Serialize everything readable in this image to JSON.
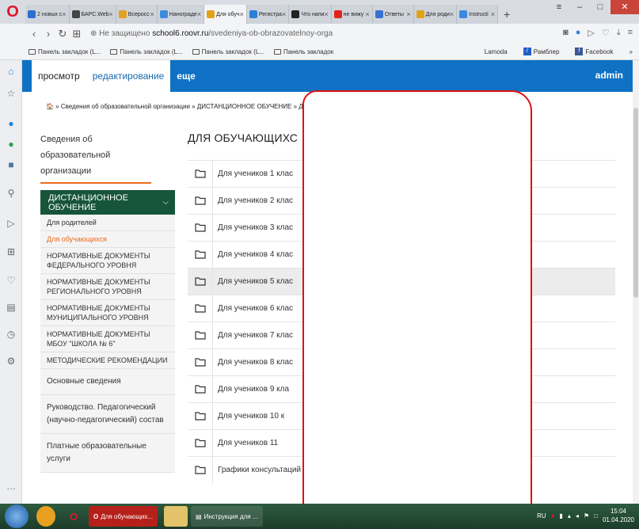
{
  "browser": {
    "tabs": [
      {
        "label": "2 новых с",
        "color": "#2b6fd1",
        "active": false
      },
      {
        "label": "БАРС.Web",
        "color": "#444444",
        "active": false
      },
      {
        "label": "Всеросс",
        "color": "#e4a020",
        "active": false
      },
      {
        "label": "Нанограде",
        "color": "#3f8be0",
        "active": false
      },
      {
        "label": "Для обуч",
        "color": "#e0a318",
        "active": true
      },
      {
        "label": "Регистра",
        "color": "#2a80d8",
        "active": false
      },
      {
        "label": "Что напи",
        "color": "#222222",
        "active": false
      },
      {
        "label": "не вижу",
        "color": "#e0231b",
        "active": false
      },
      {
        "label": "Ответы",
        "color": "#3571cf",
        "active": false
      },
      {
        "label": "Для роди",
        "color": "#e0a318",
        "active": false
      },
      {
        "label": "Instructi",
        "color": "#3a8ae0",
        "active": false
      }
    ],
    "address": {
      "security": "Не защищено",
      "host": "school6.roovr.ru",
      "path": "/svedeniya-ob-obrazovatelnoy-orga"
    },
    "bookmarks": [
      "Панель закладок (L...",
      "Панель закладок (L...",
      "Панель закладок (L...",
      "Панель закладок"
    ],
    "bookmarks_right": [
      "Lamoda",
      "Рамблер",
      "Facebook"
    ]
  },
  "admin": {
    "tabs": [
      "просмотр",
      "редактирование",
      "еще"
    ],
    "user": "admin"
  },
  "breadcrumb": "🏠 » Сведения об образовательной организации » ДИСТАНЦИОННОЕ ОБУЧЕНИЕ » Дл",
  "left": {
    "title": "Сведения об образовательной организации",
    "menu_head": "ДИСТАНЦИОННОЕ ОБУЧЕНИЕ",
    "items": [
      {
        "label": "Для родителей",
        "active": false,
        "big": false
      },
      {
        "label": "Для обучающихся",
        "active": true,
        "big": false
      },
      {
        "label": "НОРМАТИВНЫЕ ДОКУМЕНТЫ ФЕДЕРАЛЬНОГО УРОВНЯ",
        "active": false,
        "big": false
      },
      {
        "label": "НОРМАТИВНЫЕ ДОКУМЕНТЫ РЕГИОНАЛЬНОГО УРОВНЯ",
        "active": false,
        "big": false
      },
      {
        "label": "НОРМАТИВНЫЕ ДОКУМЕНТЫ МУНИЦИПАЛЬНОГО УРОВНЯ",
        "active": false,
        "big": false
      },
      {
        "label": "НОРМАТИВНЫЕ ДОКУМЕНТЫ МБОУ \"ШКОЛА № 6\"",
        "active": false,
        "big": false
      },
      {
        "label": "МЕТОДИЧЕСКИЕ РЕКОМЕНДАЦИИ",
        "active": false,
        "big": false
      },
      {
        "label": "Основные сведения",
        "active": false,
        "big": true
      },
      {
        "label": "Руководство. Педагогический (научно-педагогический) состав",
        "active": false,
        "big": true
      },
      {
        "label": "Платные образовательные услуги",
        "active": false,
        "big": true
      }
    ]
  },
  "main": {
    "title": "ДЛЯ ОБУЧАЮЩИХС",
    "folders": [
      "Для учеников 1 клас",
      "Для учеников 2 клас",
      "Для учеников 3 клас",
      "Для учеников 4 клас",
      "Для учеников 5 клас",
      "Для учеников 6 клас",
      "Для учеников 7 клас",
      "Для учеников 8 клас",
      "Для учеников 9 кла",
      "Для учеников 10 к",
      "Для учеников 11",
      "Графики консультаций"
    ]
  },
  "taskbar": {
    "tasks": [
      "Для обучающих...",
      "Инструкция для ..."
    ],
    "lang": "RU",
    "time": "15:04",
    "date": "01.04.2020"
  }
}
